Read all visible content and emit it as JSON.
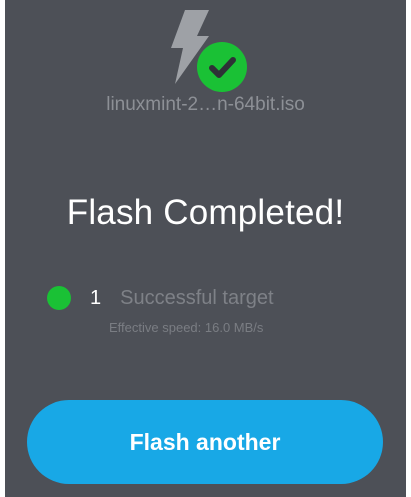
{
  "image": {
    "filename": "linuxmint-2…n-64bit.iso"
  },
  "status": {
    "title": "Flash Completed!",
    "success_count": "1",
    "success_label": "Successful target",
    "speed": "Effective speed: 16.0 MB/s"
  },
  "actions": {
    "flash_another_label": "Flash another"
  },
  "icons": {
    "logo": "lightning-bolt-icon",
    "badge": "check-circle-icon"
  },
  "colors": {
    "panel_bg": "#4d5057",
    "success_green": "#1ac135",
    "accent_blue": "#18a8e6"
  }
}
